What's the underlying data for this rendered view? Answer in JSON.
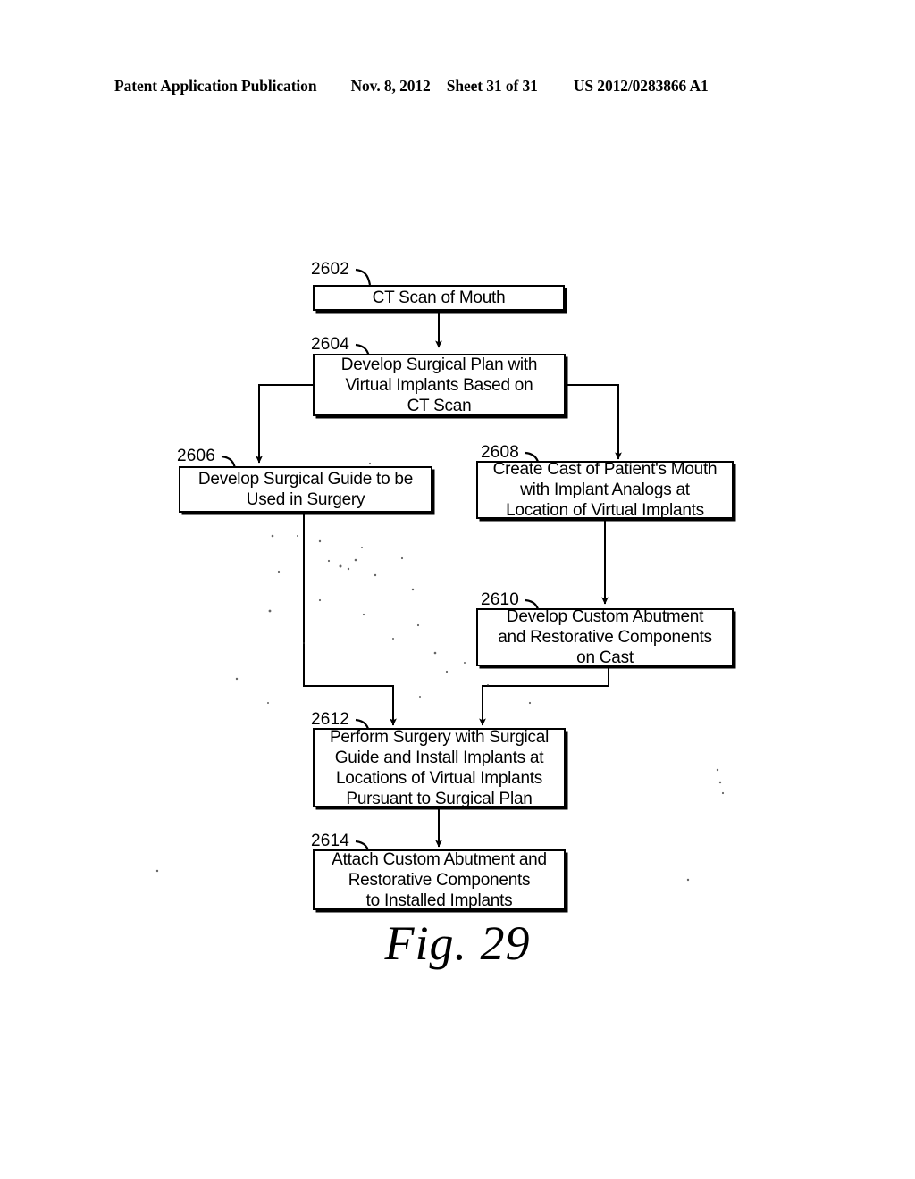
{
  "header": {
    "publication": "Patent Application Publication",
    "date": "Nov. 8, 2012",
    "sheet": "Sheet 31 of 31",
    "patent_number": "US 2012/0283866 A1"
  },
  "figure": {
    "caption": "Fig. 29",
    "type": "flowchart",
    "title_implied": "Dental implant surgical workflow"
  },
  "boxes": [
    {
      "ref": "2602",
      "text": "CT Scan of Mouth",
      "lines": [
        "CT Scan of Mouth"
      ]
    },
    {
      "ref": "2604",
      "text": "Develop Surgical Plan with\nVirtual Implants Based on\nCT Scan",
      "lines": [
        "Develop Surgical Plan with",
        "Virtual Implants Based on",
        "CT Scan"
      ]
    },
    {
      "ref": "2606",
      "text": "Develop Surgical Guide to be\nUsed in Surgery",
      "lines": [
        "Develop Surgical Guide to be",
        "Used in Surgery"
      ]
    },
    {
      "ref": "2608",
      "text": "Create Cast of Patient's Mouth\nwith Implant Analogs at\nLocation of Virtual Implants",
      "lines": [
        "Create Cast of Patient's Mouth",
        "with Implant Analogs at",
        "Location of Virtual Implants"
      ]
    },
    {
      "ref": "2610",
      "text": "Develop Custom Abutment\nand Restorative Components\non Cast",
      "lines": [
        "Develop Custom Abutment",
        "and Restorative Components",
        "on Cast"
      ]
    },
    {
      "ref": "2612",
      "text": "Perform Surgery with Surgical\nGuide and Install Implants at\nLocations of Virtual Implants\nPursuant to Surgical Plan",
      "lines": [
        "Perform Surgery with Surgical",
        "Guide and Install Implants at",
        "Locations of Virtual Implants",
        "Pursuant to Surgical Plan"
      ]
    },
    {
      "ref": "2614",
      "text": "Attach Custom Abutment and\nRestorative Components\nto Installed Implants",
      "lines": [
        "Attach Custom Abutment and",
        "Restorative Components",
        "to Installed Implants"
      ]
    }
  ],
  "connections": [
    {
      "from": "2602",
      "to": "2604",
      "label": ""
    },
    {
      "from": "2604",
      "to": "2606",
      "label": ""
    },
    {
      "from": "2604",
      "to": "2608",
      "label": ""
    },
    {
      "from": "2608",
      "to": "2610",
      "label": ""
    },
    {
      "from": "2606",
      "to": "2612",
      "label": ""
    },
    {
      "from": "2610",
      "to": "2612",
      "label": ""
    },
    {
      "from": "2612",
      "to": "2614",
      "label": ""
    }
  ],
  "colors": {
    "ink": "#000000",
    "paper": "#ffffff"
  }
}
